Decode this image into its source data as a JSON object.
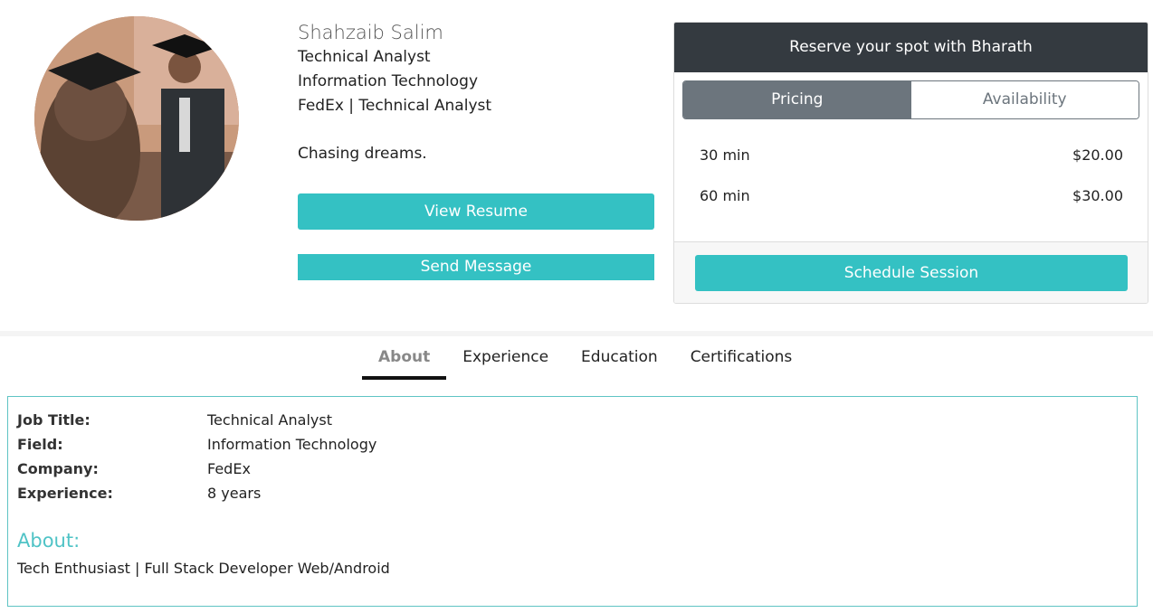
{
  "profile": {
    "name": "Shahzaib Salim",
    "title": "Technical Analyst",
    "field": "Information Technology",
    "company_line": "FedEx | Technical Analyst",
    "tagline": "Chasing dreams.",
    "view_resume_label": "View Resume",
    "send_message_label": "Send Message"
  },
  "booking": {
    "header": "Reserve your spot with Bharath",
    "tabs": [
      "Pricing",
      "Availability"
    ],
    "active_tab": "Pricing",
    "prices": [
      {
        "duration": "30 min",
        "price": "$20.00"
      },
      {
        "duration": "60 min",
        "price": "$30.00"
      }
    ],
    "schedule_label": "Schedule Session"
  },
  "tabs": [
    {
      "label": "About"
    },
    {
      "label": "Experience"
    },
    {
      "label": "Education"
    },
    {
      "label": "Certifications"
    }
  ],
  "active_tab": "About",
  "details": [
    {
      "key": "Job Title:",
      "value": "Technical Analyst"
    },
    {
      "key": "Field:",
      "value": "Information Technology"
    },
    {
      "key": "Company:",
      "value": "FedEx"
    },
    {
      "key": "Experience:",
      "value": "8 years"
    }
  ],
  "about": {
    "heading": "About:",
    "text": "Tech Enthusiast | Full Stack Developer Web/Android"
  },
  "colors": {
    "accent": "#34c1c3",
    "dark_header": "#343a40",
    "segment_active": "#6c757d"
  }
}
